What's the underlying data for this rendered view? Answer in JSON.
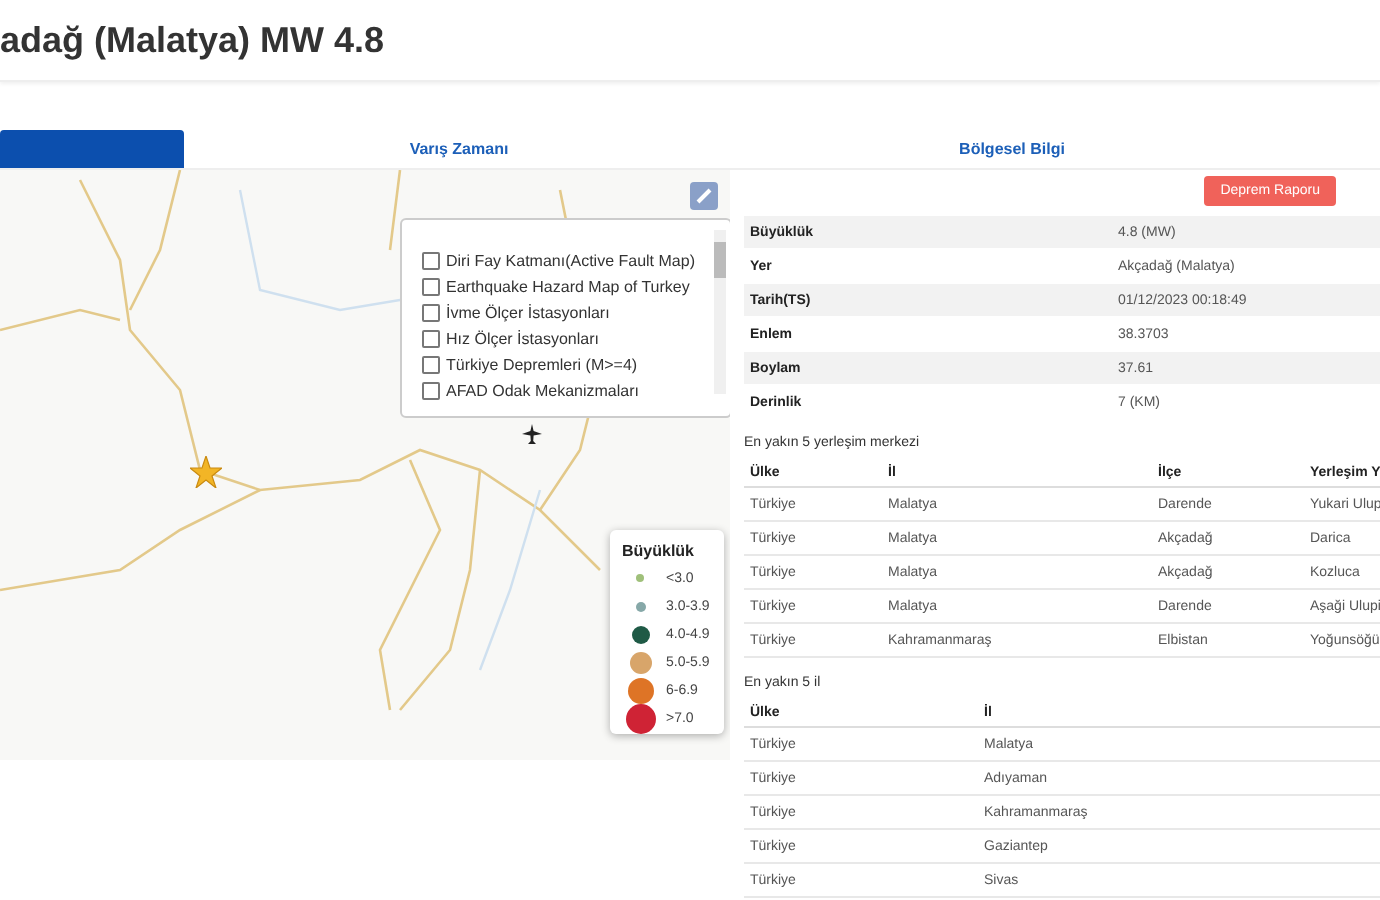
{
  "page_title": "adağ (Malatya) MW 4.8",
  "tabs": [
    {
      "selected": true
    },
    {
      "label": "Varış Zamanı",
      "selected": false
    },
    {
      "label": "Bölgesel Bilgi",
      "selected": false
    }
  ],
  "map": {
    "layers": [
      {
        "label": "Diri Fay Katmanı(Active Fault Map)",
        "checked": false
      },
      {
        "label": "Earthquake Hazard Map of Turkey",
        "checked": false
      },
      {
        "label": "İvme Ölçer İstasyonları",
        "checked": false
      },
      {
        "label": "Hız Ölçer İstasyonları",
        "checked": false
      },
      {
        "label": "Türkiye Depremleri (M>=4)",
        "checked": false
      },
      {
        "label": "AFAD Odak Mekanizmaları",
        "checked": false
      }
    ],
    "legend": {
      "title": "Büyüklük",
      "items": [
        {
          "label": "<3.0",
          "color": "#9fc07a"
        },
        {
          "label": "3.0-3.9",
          "color": "#86a8a8"
        },
        {
          "label": "4.0-4.9",
          "color": "#1f5a46"
        },
        {
          "label": "5.0-5.9",
          "color": "#d8a56a"
        },
        {
          "label": "6-6.9",
          "color": "#de7426"
        },
        {
          "label": ">7.0",
          "color": "#cf2335"
        }
      ]
    }
  },
  "report_button": "Deprem Raporu",
  "details": [
    {
      "label": "Büyüklük",
      "value": "4.8 (MW)"
    },
    {
      "label": "Yer",
      "value": "Akçadağ (Malatya)"
    },
    {
      "label": "Tarih(TS)",
      "value": "01/12/2023 00:18:49"
    },
    {
      "label": "Enlem",
      "value": "38.3703"
    },
    {
      "label": "Boylam",
      "value": "37.61"
    },
    {
      "label": "Derinlik",
      "value": "7 (KM)"
    }
  ],
  "settlements": {
    "caption": "En yakın 5 yerleşim merkezi",
    "columns": [
      "Ülke",
      "İl",
      "İlçe",
      "Yerleşim Y"
    ],
    "rows": [
      [
        "Türkiye",
        "Malatya",
        "Darende",
        "Yukari Ulup"
      ],
      [
        "Türkiye",
        "Malatya",
        "Akçadağ",
        "Darica"
      ],
      [
        "Türkiye",
        "Malatya",
        "Akçadağ",
        "Kozluca"
      ],
      [
        "Türkiye",
        "Malatya",
        "Darende",
        "Aşaği Ulupi"
      ],
      [
        "Türkiye",
        "Kahramanmaraş",
        "Elbistan",
        "Yoğunsöğü"
      ]
    ]
  },
  "provinces": {
    "caption": "En yakın 5 il",
    "columns": [
      "Ülke",
      "İl"
    ],
    "rows": [
      [
        "Türkiye",
        "Malatya"
      ],
      [
        "Türkiye",
        "Adıyaman"
      ],
      [
        "Türkiye",
        "Kahramanmaraş"
      ],
      [
        "Türkiye",
        "Gaziantep"
      ],
      [
        "Türkiye",
        "Sivas"
      ]
    ]
  }
}
